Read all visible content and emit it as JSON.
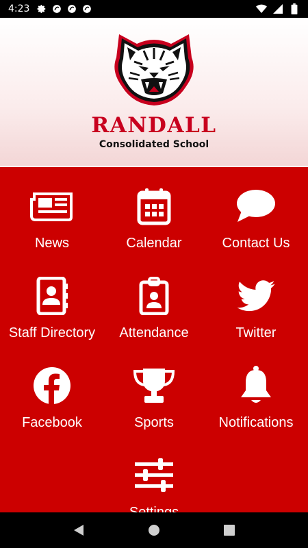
{
  "status_bar": {
    "time": "4:23",
    "left_icons": [
      "settings-gear-icon",
      "sync-icon",
      "sync-icon",
      "sync-icon"
    ],
    "right_icons": [
      "wifi-icon",
      "signal-icon",
      "battery-icon"
    ]
  },
  "header": {
    "school_name": "RANDALL",
    "school_subtitle": "Consolidated School",
    "brand_color": "#cc0000"
  },
  "menu": {
    "items": [
      {
        "label": "News",
        "icon": "newspaper-icon"
      },
      {
        "label": "Calendar",
        "icon": "calendar-icon"
      },
      {
        "label": "Contact Us",
        "icon": "chat-bubble-icon"
      },
      {
        "label": "Staff Directory",
        "icon": "address-book-icon"
      },
      {
        "label": "Attendance",
        "icon": "id-badge-icon"
      },
      {
        "label": "Twitter",
        "icon": "twitter-bird-icon"
      },
      {
        "label": "Facebook",
        "icon": "facebook-icon"
      },
      {
        "label": "Sports",
        "icon": "trophy-icon"
      },
      {
        "label": "Notifications",
        "icon": "bell-icon"
      },
      {
        "label": "Settings",
        "icon": "sliders-icon"
      }
    ]
  },
  "nav_bar": {
    "buttons": [
      "back-icon",
      "home-icon",
      "recents-icon"
    ]
  }
}
